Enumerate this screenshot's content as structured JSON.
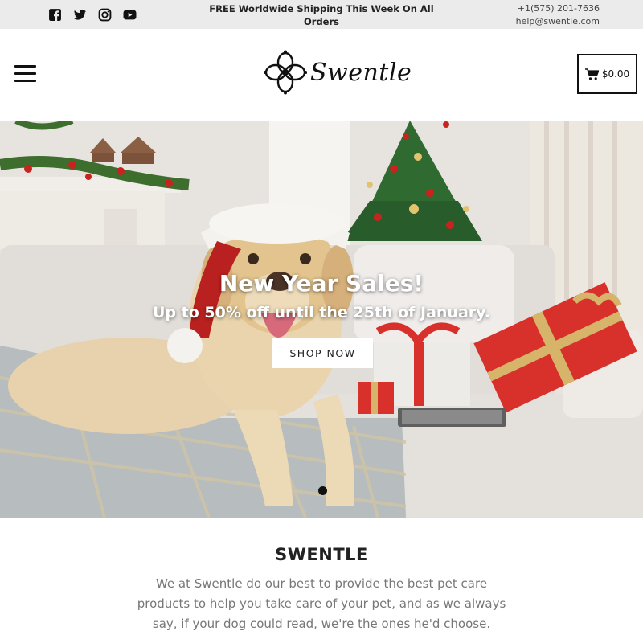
{
  "topbar": {
    "social_icons": [
      "facebook-icon",
      "twitter-icon",
      "instagram-icon",
      "youtube-icon"
    ],
    "announcement": "FREE Worldwide Shipping This Week On All Orders",
    "phone": "+1(575) 201-7636",
    "email": "help@swentle.com"
  },
  "header": {
    "menu_icon": "hamburger-menu-icon",
    "logo_text": "Swentle",
    "cart_icon": "cart-icon",
    "cart_total": "$0.00"
  },
  "hero": {
    "title": "New Year Sales!",
    "subtitle": "Up to 50% off until the 25th of January.",
    "button_label": "SHOP NOW",
    "slide_count": 1,
    "active_slide": 1
  },
  "about": {
    "title": "SWENTLE",
    "text": "We at Swentle do our best to provide the best pet care products to help you take care of your pet, and as we always say, if your dog could read, we're the ones he'd choose."
  },
  "colors": {
    "topbar_bg": "#ebebeb",
    "text_dark": "#111111",
    "body_text": "#777777",
    "gift_red": "#d8302b",
    "ribbon_gold": "#d6b56a"
  }
}
